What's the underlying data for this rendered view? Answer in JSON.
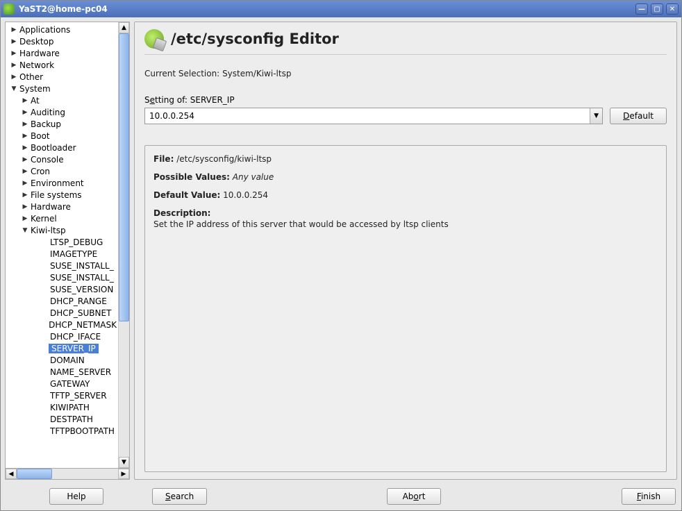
{
  "window": {
    "title": "YaST2@home-pc04"
  },
  "header": {
    "title": "/etc/sysconfig Editor"
  },
  "selection": {
    "label": "Current Selection:",
    "path": "System/Kiwi-ltsp"
  },
  "setting": {
    "label_prefix": "S",
    "label_underline": "e",
    "label_suffix": "tting of: SERVER_IP",
    "value": "10.0.0.254",
    "default_btn_u": "D",
    "default_btn_rest": "efault"
  },
  "details": {
    "file_label": "File:",
    "file_value": "/etc/sysconfig/kiwi-ltsp",
    "possible_label": "Possible Values:",
    "possible_value": "Any value",
    "default_label": "Default Value:",
    "default_value": "10.0.0.254",
    "description_label": "Description:",
    "description_text": "Set the IP address of this server that would be accessed by ltsp clients"
  },
  "footer": {
    "help": "Help",
    "search_u": "S",
    "search_rest": "earch",
    "abort_prefix": "Ab",
    "abort_u": "o",
    "abort_rest": "rt",
    "finish_u": "F",
    "finish_rest": "inish"
  },
  "tree": [
    {
      "label": "Applications",
      "level": 0,
      "expander": "▶"
    },
    {
      "label": "Desktop",
      "level": 0,
      "expander": "▶"
    },
    {
      "label": "Hardware",
      "level": 0,
      "expander": "▶"
    },
    {
      "label": "Network",
      "level": 0,
      "expander": "▶"
    },
    {
      "label": "Other",
      "level": 0,
      "expander": "▶"
    },
    {
      "label": "System",
      "level": 0,
      "expander": "▼"
    },
    {
      "label": "At",
      "level": 1,
      "expander": "▶"
    },
    {
      "label": "Auditing",
      "level": 1,
      "expander": "▶"
    },
    {
      "label": "Backup",
      "level": 1,
      "expander": "▶"
    },
    {
      "label": "Boot",
      "level": 1,
      "expander": "▶"
    },
    {
      "label": "Bootloader",
      "level": 1,
      "expander": "▶"
    },
    {
      "label": "Console",
      "level": 1,
      "expander": "▶"
    },
    {
      "label": "Cron",
      "level": 1,
      "expander": "▶"
    },
    {
      "label": "Environment",
      "level": 1,
      "expander": "▶"
    },
    {
      "label": "File systems",
      "level": 1,
      "expander": "▶"
    },
    {
      "label": "Hardware",
      "level": 1,
      "expander": "▶"
    },
    {
      "label": "Kernel",
      "level": 1,
      "expander": "▶"
    },
    {
      "label": "Kiwi-ltsp",
      "level": 1,
      "expander": "▼"
    },
    {
      "label": "LTSP_DEBUG",
      "level": 2,
      "expander": ""
    },
    {
      "label": "IMAGETYPE",
      "level": 2,
      "expander": ""
    },
    {
      "label": "SUSE_INSTALL_",
      "level": 2,
      "expander": ""
    },
    {
      "label": "SUSE_INSTALL_",
      "level": 2,
      "expander": ""
    },
    {
      "label": "SUSE_VERSION",
      "level": 2,
      "expander": ""
    },
    {
      "label": "DHCP_RANGE",
      "level": 2,
      "expander": ""
    },
    {
      "label": "DHCP_SUBNET",
      "level": 2,
      "expander": ""
    },
    {
      "label": "DHCP_NETMASK",
      "level": 2,
      "expander": ""
    },
    {
      "label": "DHCP_IFACE",
      "level": 2,
      "expander": ""
    },
    {
      "label": "SERVER_IP",
      "level": 2,
      "expander": "",
      "selected": true
    },
    {
      "label": "DOMAIN",
      "level": 2,
      "expander": ""
    },
    {
      "label": "NAME_SERVER",
      "level": 2,
      "expander": ""
    },
    {
      "label": "GATEWAY",
      "level": 2,
      "expander": ""
    },
    {
      "label": "TFTP_SERVER",
      "level": 2,
      "expander": ""
    },
    {
      "label": "KIWIPATH",
      "level": 2,
      "expander": ""
    },
    {
      "label": "DESTPATH",
      "level": 2,
      "expander": ""
    },
    {
      "label": "TFTPBOOTPATH",
      "level": 2,
      "expander": ""
    }
  ]
}
